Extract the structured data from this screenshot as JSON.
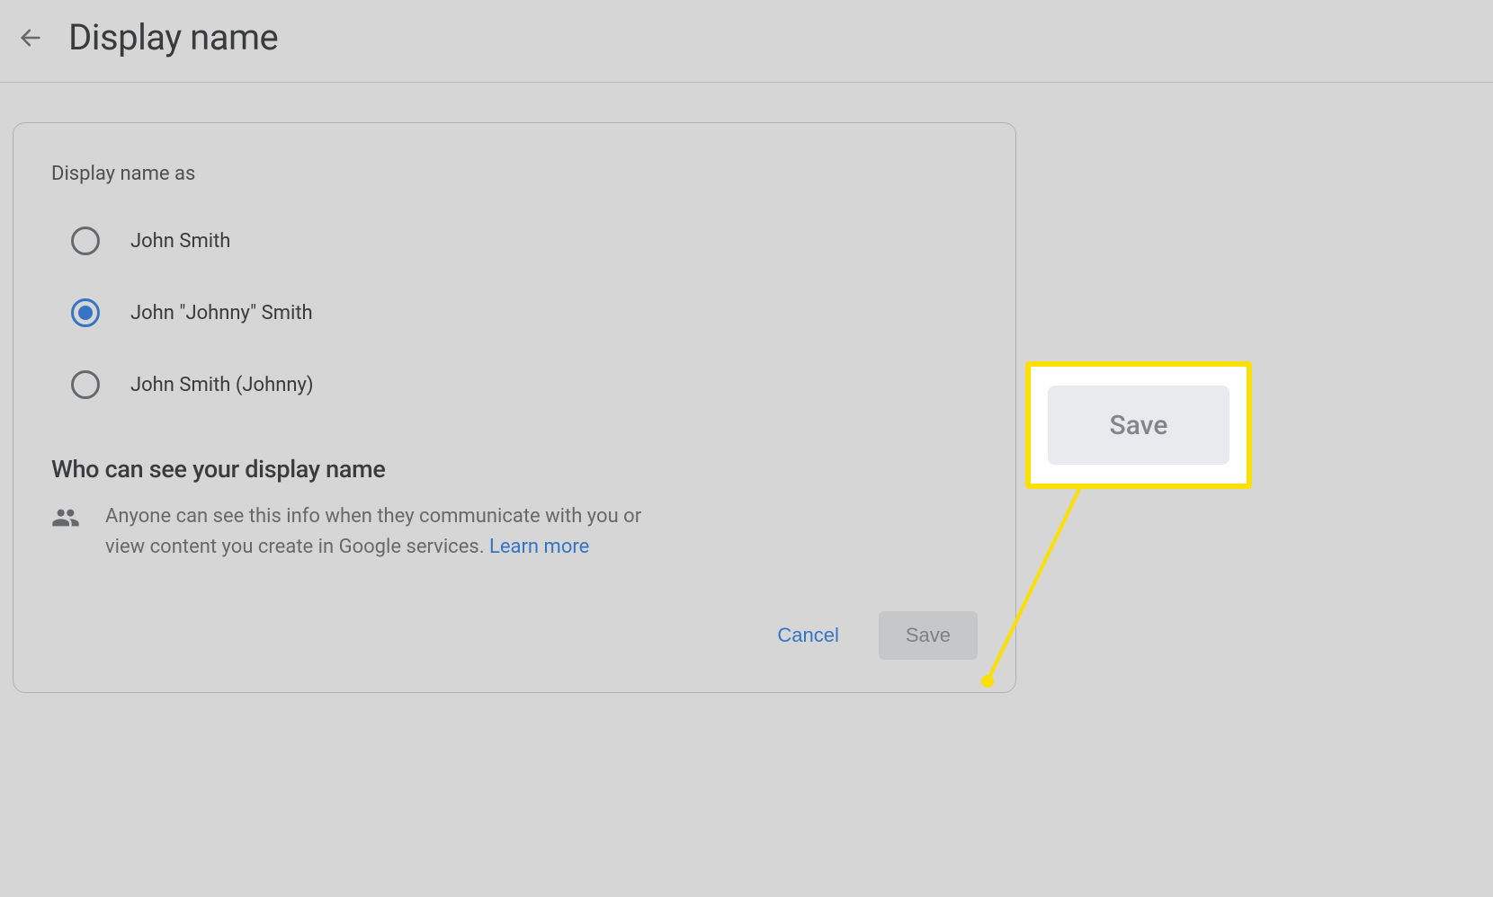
{
  "header": {
    "title": "Display name"
  },
  "card": {
    "section_label": "Display name as",
    "options": [
      {
        "label": "John Smith",
        "selected": false
      },
      {
        "label": "John \"Johnny\" Smith",
        "selected": true
      },
      {
        "label": "John Smith (Johnny)",
        "selected": false
      }
    ],
    "visibility_heading": "Who can see your display name",
    "visibility_text": "Anyone can see this info when they communicate with you or view content you create in Google services. ",
    "learn_more": "Learn more",
    "cancel_label": "Cancel",
    "save_label": "Save"
  },
  "callout": {
    "zoom_label": "Save"
  },
  "colors": {
    "accent": "#1a73e8",
    "highlight": "#fcdf03",
    "muted": "#5f6368"
  }
}
